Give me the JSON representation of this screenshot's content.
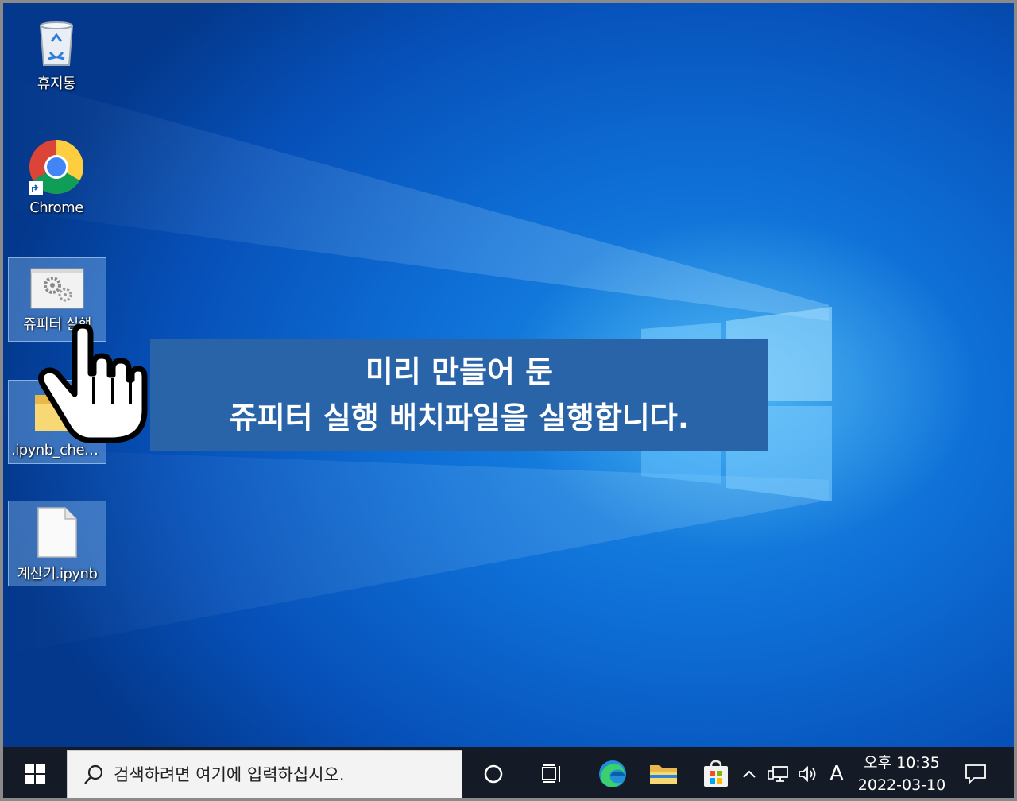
{
  "desktop": {
    "icons": [
      {
        "label": "휴지통"
      },
      {
        "label": "Chrome"
      },
      {
        "label": "쥬피터 실행"
      },
      {
        "label": ".ipynb_chec..."
      },
      {
        "label": "계산기.ipynb"
      }
    ]
  },
  "callout": {
    "line1": "미리 만들어 둔",
    "line2": "쥬피터 실행 배치파일을 실행합니다."
  },
  "taskbar": {
    "search_placeholder": "검색하려면 여기에 입력하십시오.",
    "ime_indicator": "A",
    "clock": {
      "time": "오후 10:35",
      "date": "2022-03-10"
    }
  },
  "colors": {
    "taskbar": "#151b26",
    "callout": "#2a64a8",
    "desktop_accent": "#0e6fd6"
  }
}
